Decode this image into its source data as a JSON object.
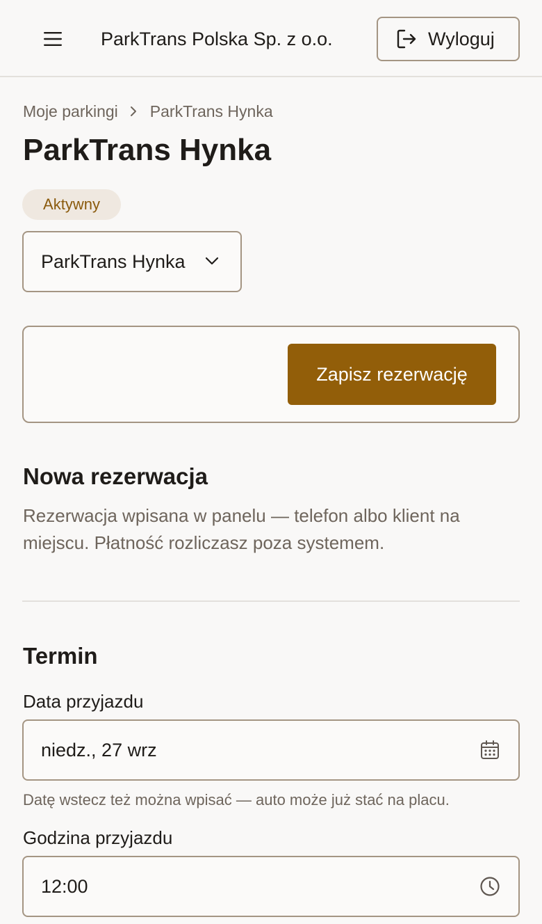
{
  "header": {
    "company": "ParkTrans Polska Sp. z o.o.",
    "logout_label": "Wyloguj",
    "icons": {
      "menu": "hamburger-menu-icon",
      "logout": "logout-icon"
    }
  },
  "breadcrumb": {
    "parent": "Moje parkingi",
    "current": "ParkTrans Hynka"
  },
  "page": {
    "title": "ParkTrans Hynka",
    "status_badge": "Aktywny"
  },
  "parking_select": {
    "selected": "ParkTrans Hynka"
  },
  "actions": {
    "save_label": "Zapisz rezerwację"
  },
  "new_reservation": {
    "title": "Nowa rezerwacja",
    "description": "Rezerwacja wpisana w panelu — telefon albo klient na miejscu. Płatność rozliczasz poza systemem."
  },
  "term": {
    "title": "Termin",
    "arrival_date": {
      "label": "Data przyjazdu",
      "value": "niedz., 27 wrz",
      "hint": "Datę wstecz też można wpisać — auto może już stać na placu."
    },
    "arrival_time": {
      "label": "Godzina przyjazdu",
      "value": "12:00"
    }
  },
  "colors": {
    "accent": "#925e09",
    "badge_bg": "#efe8e0",
    "badge_text": "#8a5a0c",
    "border": "#a49583",
    "muted_text": "#6e655c",
    "background": "#f9f8f7"
  }
}
